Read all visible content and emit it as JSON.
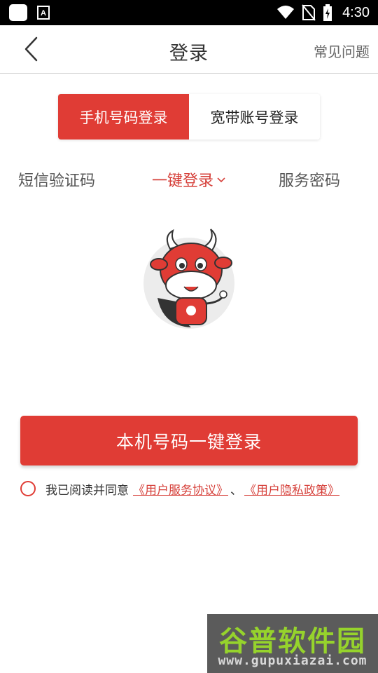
{
  "status_bar": {
    "time": "4:30"
  },
  "header": {
    "title": "登录",
    "faq_label": "常见问题"
  },
  "login_tabs": [
    {
      "label": "手机号码登录",
      "active": true
    },
    {
      "label": "宽带账号登录",
      "active": false
    }
  ],
  "sub_tabs": [
    {
      "label": "短信验证码",
      "active": false
    },
    {
      "label": "一键登录",
      "active": true
    },
    {
      "label": "服务密码",
      "active": false
    }
  ],
  "login_button": {
    "label": "本机号码一键登录"
  },
  "agreement": {
    "text": "我已阅读并同意",
    "link1": "《用户服务协议》",
    "separator": "、",
    "link2": "《用户隐私政策》",
    "checked": false
  },
  "watermark": {
    "title": "谷普软件园",
    "url": "www.gupuxiazai.com"
  },
  "colors": {
    "accent": "#e03c35",
    "status_bar": "#000000",
    "text": "#333333"
  },
  "icons": [
    "app-icon",
    "a-icon",
    "wifi-icon",
    "no-sim-icon",
    "battery-icon",
    "back-arrow-icon",
    "chevron-down-icon",
    "mascot-icon",
    "radio-icon"
  ]
}
